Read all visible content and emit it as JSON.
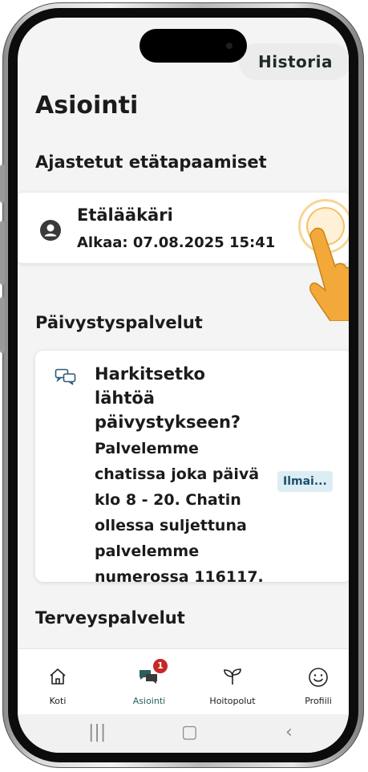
{
  "header": {
    "history_label": "Historia"
  },
  "page": {
    "title": "Asiointi"
  },
  "sections": {
    "appointments_title": "Ajastetut etätapaamiset",
    "emergency_title": "Päivystyspalvelut",
    "health_title": "Terveyspalvelut"
  },
  "appointment": {
    "name": "Etälääkäri",
    "start": "Alkaa: 07.08.2025 15:41",
    "icon": "person-circle-icon"
  },
  "emergency": {
    "heading": "Harkitsetko lähtöä päivystykseen?",
    "lines": [
      "Palvelemme",
      "chatissa joka päivä",
      "klo 8 - 20. Chatin",
      "ollessa suljettuna",
      "palvelemme",
      "numerossa 116117."
    ],
    "badge": "Ilmai...",
    "icon": "chat-bubbles-icon"
  },
  "nav": {
    "items": [
      {
        "label": "Koti",
        "icon": "home-icon"
      },
      {
        "label": "Asiointi",
        "icon": "chat-icon",
        "badge": "1",
        "active": true
      },
      {
        "label": "Hoitopolut",
        "icon": "sprout-icon"
      },
      {
        "label": "Profiili",
        "icon": "smiley-icon"
      }
    ]
  },
  "system_nav": {
    "recents": "|||",
    "home": "▢",
    "back": "‹"
  },
  "colors": {
    "accent": "#2c5e5e",
    "badge": "#c62828",
    "info_bg": "#dceef4",
    "tap": "#f3b23c"
  }
}
